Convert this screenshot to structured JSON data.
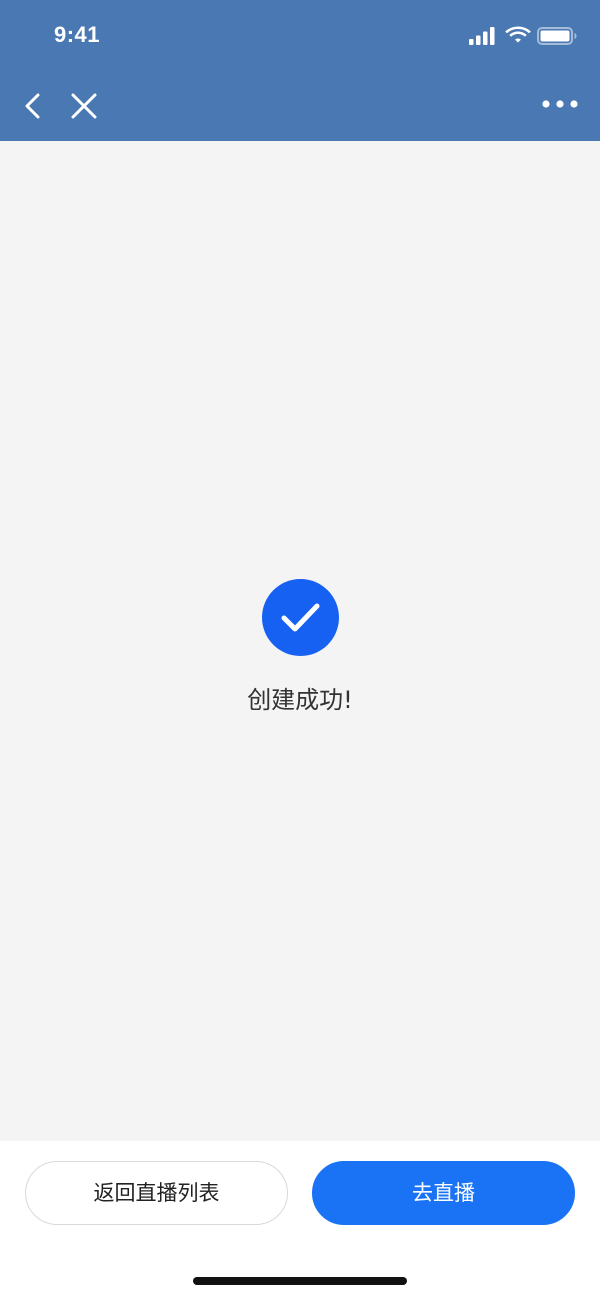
{
  "status_bar": {
    "time": "9:41"
  },
  "nav": {
    "back_icon": "chevron-left-icon",
    "close_icon": "close-icon",
    "more_icon": "more-horizontal-icon"
  },
  "result": {
    "icon": "check-circle-icon",
    "message": "创建成功!"
  },
  "actions": {
    "back_to_list_label": "返回直播列表",
    "go_live_label": "去直播"
  },
  "colors": {
    "header_bg": "#4a78b3",
    "accent": "#1a73f5",
    "page_bg": "#f4f4f5"
  }
}
